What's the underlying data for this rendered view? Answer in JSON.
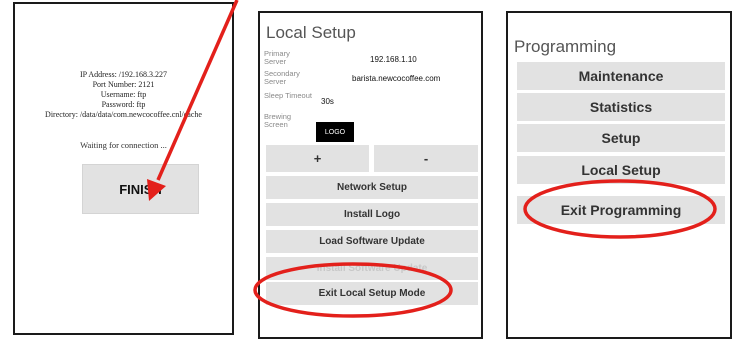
{
  "screen1": {
    "info_lines": [
      "IP Address: /192.168.3.227",
      "Port Number: 2121",
      "Username: ftp",
      "Password: ftp",
      "Directory: /data/data/com.newcocoffee.cnl/cache"
    ],
    "waiting_text": "Waiting for connection ...",
    "finish_label": "FINISH"
  },
  "screen2": {
    "title": "Local Setup",
    "primary_server_label": "Primary Server",
    "primary_server_value": "192.168.1.10",
    "secondary_server_label": "Secondary Server",
    "secondary_server_value": "barista.newcocoffee.com",
    "sleep_timeout_label": "Sleep Timeout",
    "sleep_timeout_value": "30s",
    "brewing_screen_label": "Brewing Screen",
    "logo_label": "LOGO",
    "plus_label": "+",
    "minus_label": "-",
    "network_setup_label": "Network Setup",
    "install_logo_label": "Install Logo",
    "load_software_update_label": "Load Software Update",
    "install_software_update_label": "Install Software Update",
    "exit_local_setup_label": "Exit Local Setup Mode"
  },
  "screen3": {
    "title": "Programming",
    "maintenance_label": "Maintenance",
    "statistics_label": "Statistics",
    "setup_label": "Setup",
    "local_setup_label": "Local Setup",
    "exit_programming_label": "Exit Programming"
  },
  "annotation_color": "#e3201b"
}
